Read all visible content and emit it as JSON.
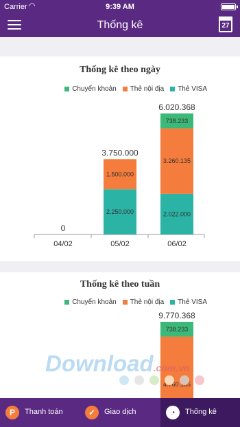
{
  "status": {
    "carrier": "Carrier",
    "time": "9:39 AM"
  },
  "nav": {
    "title": "Thống kê",
    "calendar_day": "27"
  },
  "legend": [
    {
      "label": "Chuyển khoản",
      "color": "#3cb878"
    },
    {
      "label": "Thẻ nội địa",
      "color": "#f47c3c"
    },
    {
      "label": "Thẻ VISA",
      "color": "#2bb3a6"
    }
  ],
  "chart_data": [
    {
      "type": "bar",
      "stacked": true,
      "title": "Thống kê theo ngày",
      "categories": [
        "04/02",
        "05/02",
        "06/02"
      ],
      "series": [
        {
          "name": "Thẻ VISA",
          "values": [
            0,
            2250000
          ],
          "value_labels": [
            "",
            "2.250.000",
            "2.022.000"
          ]
        },
        {
          "name": "Thẻ nội địa",
          "values": [
            0,
            1500000
          ],
          "value_labels": [
            "",
            "1.500.000",
            "3.260.135"
          ]
        },
        {
          "name": "Chuyển khoản",
          "values": [
            0,
            0,
            738233
          ],
          "value_labels": [
            "",
            "",
            "738.233"
          ]
        }
      ],
      "totals": [
        "0",
        "3.750.000",
        "6.020.368"
      ],
      "legend_position": "top-right"
    },
    {
      "type": "bar",
      "stacked": true,
      "title": "Thống kê theo tuần",
      "categories": [
        ""
      ],
      "series": [
        {
          "name": "Thẻ nội địa",
          "values": [
            4760135
          ],
          "value_labels": [
            "4.760.135"
          ]
        },
        {
          "name": "Chuyển khoản",
          "values": [
            738233
          ],
          "value_labels": [
            "738.233"
          ]
        }
      ],
      "totals": [
        "9.770.368"
      ],
      "legend_position": "top-right"
    }
  ],
  "tabs": [
    {
      "label": "Thanh toán",
      "icon": "P",
      "icon_color": "#f47c3c"
    },
    {
      "label": "Giao dịch",
      "icon": "✓",
      "icon_color": "#f47c3c"
    },
    {
      "label": "Thống kê",
      "icon": "◔",
      "icon_color": "#ffffff"
    }
  ],
  "watermark": {
    "text": "Download",
    "suffix": ".com.vn"
  },
  "dot_colors": [
    "#cfe6f5",
    "#e6e6e6",
    "#d8ecc8",
    "#fbd9b8",
    "#d9c3b8",
    "#f7c7cc"
  ]
}
